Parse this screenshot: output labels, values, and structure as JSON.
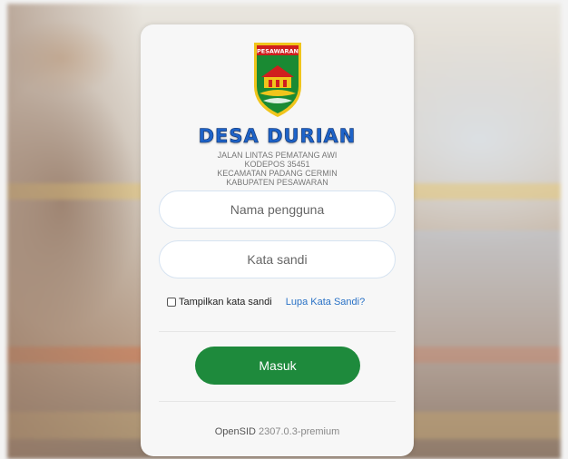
{
  "logo": {
    "banner_text": "PESAWARAN",
    "colors": {
      "banner": "#d01e1e",
      "shield": "#1a8a33",
      "border": "#f0c51c"
    }
  },
  "header": {
    "title": "DESA DURIAN",
    "address_lines": [
      "JALAN LINTAS PEMATANG AWI",
      "KODEPOS 35451",
      "KECAMATAN PADANG CERMIN",
      "KABUPATEN PESAWARAN"
    ]
  },
  "form": {
    "username_placeholder": "Nama pengguna",
    "password_placeholder": "Kata sandi",
    "show_password_label": "Tampilkan kata sandi",
    "forgot_password_label": "Lupa Kata Sandi?",
    "submit_label": "Masuk"
  },
  "footer": {
    "brand": "OpenSID",
    "version": "2307.0.3-premium"
  },
  "theme": {
    "accent": "#1e8a3c",
    "title_color": "#1e63c8",
    "link_color": "#2a72c6"
  }
}
